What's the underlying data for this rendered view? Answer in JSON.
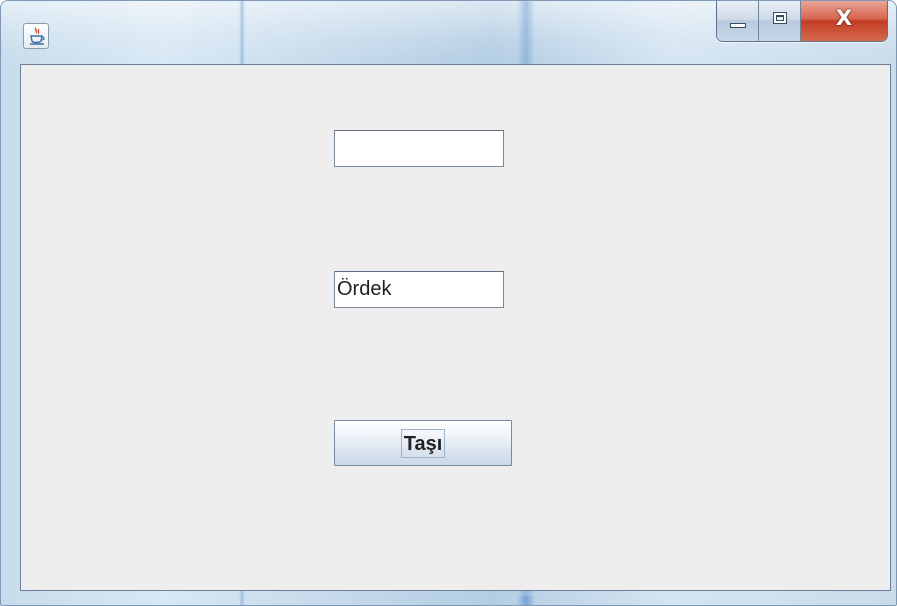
{
  "window": {
    "app_icon": "java-cup-icon",
    "controls": {
      "minimize": "minimize-icon",
      "maximize": "maximize-icon",
      "close_label": "X"
    }
  },
  "form": {
    "field_top": {
      "value": "",
      "placeholder": ""
    },
    "field_bottom": {
      "value": "Ördek",
      "placeholder": ""
    },
    "move_button_label": "Taşı"
  }
}
